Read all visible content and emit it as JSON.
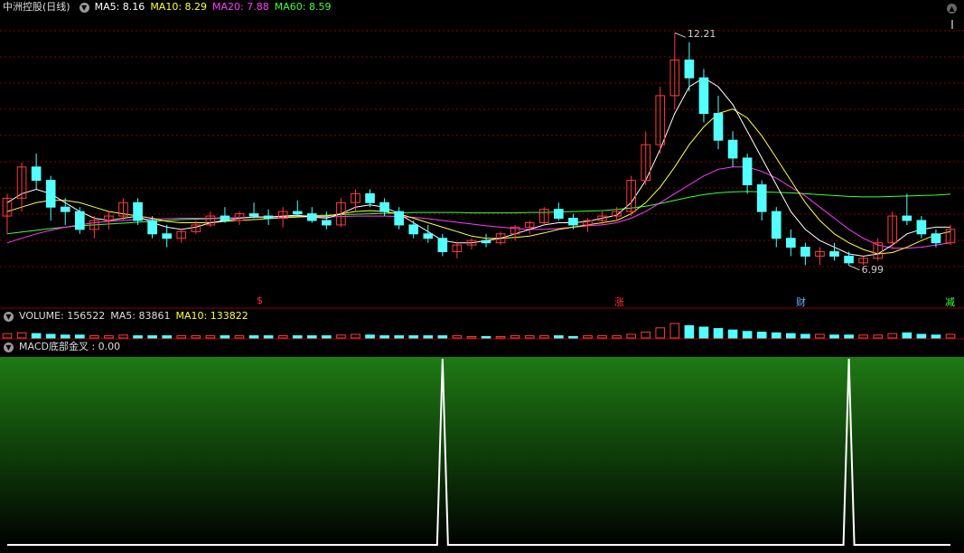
{
  "price_panel": {
    "title": "中洲控股(日线)",
    "ma_labels": [
      {
        "text": "MA5: 8.16",
        "color": "#ffffff"
      },
      {
        "text": "MA10: 8.29",
        "color": "#ffff3c"
      },
      {
        "text": "MA20: 7.88",
        "color": "#ff3cff"
      },
      {
        "text": "MA60: 8.59",
        "color": "#3cff3c"
      }
    ],
    "high_label": "12.21",
    "low_label": "6.99",
    "signals": [
      {
        "text": "$",
        "color": "#ff3030"
      },
      {
        "text": "涨",
        "color": "#ff3030"
      },
      {
        "text": "财",
        "color": "#6ab0ff"
      },
      {
        "text": "减",
        "color": "#3cff3c"
      }
    ]
  },
  "volume_panel": {
    "labels": [
      {
        "text": "VOLUME: 156522",
        "color": "#dddddd"
      },
      {
        "text": "MA5: 83861",
        "color": "#dddddd"
      },
      {
        "text": "MA10: 133822",
        "color": "#ffff3c"
      }
    ]
  },
  "macd_panel": {
    "label": "MACD底部金叉 : 0.00"
  },
  "colors": {
    "up": "#ff3c3c",
    "down": "#54ffff",
    "ma5": "#ffffff",
    "ma10": "#ffff3c",
    "ma20": "#ff3cff",
    "ma60": "#3cff3c",
    "grid": "#8b0000",
    "macd_bg_top": "#1f7a14",
    "macd_bg_bottom": "#000000"
  },
  "chart_data": {
    "type": "candlestick",
    "y_range": [
      6.5,
      12.5
    ],
    "ohlc": [
      [
        8.1,
        8.6,
        7.7,
        8.5
      ],
      [
        8.5,
        9.3,
        8.2,
        9.2
      ],
      [
        9.2,
        9.5,
        8.7,
        8.9
      ],
      [
        8.9,
        9.0,
        8.0,
        8.3
      ],
      [
        8.3,
        8.5,
        7.9,
        8.2
      ],
      [
        8.2,
        8.3,
        7.7,
        7.8
      ],
      [
        7.8,
        8.1,
        7.6,
        8.0
      ],
      [
        8.0,
        8.2,
        7.8,
        8.1
      ],
      [
        8.1,
        8.5,
        8.0,
        8.4
      ],
      [
        8.4,
        8.5,
        7.9,
        8.0
      ],
      [
        8.0,
        8.1,
        7.6,
        7.7
      ],
      [
        7.7,
        7.9,
        7.4,
        7.6
      ],
      [
        7.6,
        7.8,
        7.5,
        7.75
      ],
      [
        7.75,
        8.0,
        7.7,
        7.9
      ],
      [
        7.9,
        8.2,
        7.85,
        8.1
      ],
      [
        8.1,
        8.3,
        7.95,
        8.0
      ],
      [
        8.0,
        8.2,
        7.9,
        8.15
      ],
      [
        8.15,
        8.4,
        8.05,
        8.1
      ],
      [
        8.1,
        8.25,
        7.9,
        8.05
      ],
      [
        8.05,
        8.3,
        7.85,
        8.2
      ],
      [
        8.2,
        8.45,
        8.1,
        8.15
      ],
      [
        8.15,
        8.3,
        7.95,
        8.0
      ],
      [
        8.0,
        8.2,
        7.8,
        7.9
      ],
      [
        7.9,
        8.5,
        7.85,
        8.4
      ],
      [
        8.4,
        8.7,
        8.2,
        8.6
      ],
      [
        8.6,
        8.7,
        8.3,
        8.4
      ],
      [
        8.4,
        8.5,
        8.1,
        8.2
      ],
      [
        8.2,
        8.3,
        7.8,
        7.9
      ],
      [
        7.9,
        8.0,
        7.6,
        7.7
      ],
      [
        7.7,
        7.9,
        7.5,
        7.6
      ],
      [
        7.6,
        7.7,
        7.2,
        7.3
      ],
      [
        7.3,
        7.5,
        7.15,
        7.45
      ],
      [
        7.45,
        7.6,
        7.35,
        7.55
      ],
      [
        7.55,
        7.7,
        7.4,
        7.5
      ],
      [
        7.5,
        7.75,
        7.45,
        7.7
      ],
      [
        7.7,
        7.9,
        7.55,
        7.85
      ],
      [
        7.85,
        8.0,
        7.7,
        7.95
      ],
      [
        7.95,
        8.3,
        7.9,
        8.25
      ],
      [
        8.25,
        8.4,
        8.0,
        8.05
      ],
      [
        8.05,
        8.15,
        7.8,
        7.9
      ],
      [
        7.9,
        8.05,
        7.75,
        8.0
      ],
      [
        8.0,
        8.2,
        7.9,
        8.1
      ],
      [
        8.1,
        8.3,
        8.0,
        8.2
      ],
      [
        8.2,
        9.0,
        8.1,
        8.9
      ],
      [
        8.9,
        10.0,
        8.8,
        9.7
      ],
      [
        9.7,
        11.0,
        9.5,
        10.8
      ],
      [
        10.8,
        12.21,
        10.5,
        11.6
      ],
      [
        11.6,
        12.0,
        10.9,
        11.2
      ],
      [
        11.2,
        11.4,
        10.2,
        10.4
      ],
      [
        10.4,
        10.8,
        9.6,
        9.8
      ],
      [
        9.8,
        10.0,
        9.2,
        9.4
      ],
      [
        9.4,
        9.5,
        8.6,
        8.8
      ],
      [
        8.8,
        8.9,
        8.0,
        8.2
      ],
      [
        8.2,
        8.3,
        7.4,
        7.6
      ],
      [
        7.6,
        7.8,
        7.2,
        7.4
      ],
      [
        7.4,
        7.5,
        7.0,
        7.2
      ],
      [
        7.2,
        7.4,
        7.0,
        7.3
      ],
      [
        7.3,
        7.5,
        7.1,
        7.2
      ],
      [
        7.2,
        7.3,
        6.99,
        7.05
      ],
      [
        7.05,
        7.2,
        7.0,
        7.15
      ],
      [
        7.15,
        7.6,
        7.1,
        7.5
      ],
      [
        7.5,
        8.2,
        7.4,
        8.1
      ],
      [
        8.1,
        8.6,
        7.9,
        8.0
      ],
      [
        8.0,
        8.1,
        7.6,
        7.7
      ],
      [
        7.7,
        7.8,
        7.4,
        7.5
      ],
      [
        7.5,
        7.9,
        7.45,
        7.8
      ]
    ],
    "ma5": [
      8.4,
      8.6,
      8.7,
      8.6,
      8.4,
      8.2,
      8.05,
      8.0,
      8.05,
      8.1,
      7.95,
      7.85,
      7.8,
      7.85,
      7.95,
      8.0,
      8.05,
      8.08,
      8.08,
      8.1,
      8.12,
      8.08,
      8.05,
      8.15,
      8.3,
      8.35,
      8.3,
      8.15,
      7.95,
      7.75,
      7.55,
      7.5,
      7.5,
      7.55,
      7.6,
      7.7,
      7.8,
      7.9,
      7.95,
      7.95,
      7.98,
      8.05,
      8.12,
      8.4,
      8.9,
      9.6,
      10.4,
      11.0,
      11.2,
      11.0,
      10.6,
      10.0,
      9.4,
      8.8,
      8.2,
      7.8,
      7.55,
      7.4,
      7.25,
      7.2,
      7.25,
      7.45,
      7.7,
      7.8,
      7.85,
      7.85
    ],
    "ma10": [
      8.2,
      8.3,
      8.4,
      8.45,
      8.45,
      8.4,
      8.3,
      8.2,
      8.15,
      8.1,
      8.05,
      7.98,
      7.95,
      7.95,
      7.95,
      7.98,
      8.0,
      8.02,
      8.04,
      8.06,
      8.08,
      8.1,
      8.1,
      8.15,
      8.2,
      8.22,
      8.2,
      8.15,
      8.05,
      7.95,
      7.85,
      7.75,
      7.65,
      7.6,
      7.6,
      7.62,
      7.65,
      7.72,
      7.8,
      7.85,
      7.9,
      7.95,
      8.0,
      8.15,
      8.4,
      8.75,
      9.2,
      9.7,
      10.1,
      10.4,
      10.5,
      10.3,
      9.9,
      9.4,
      8.9,
      8.4,
      8.0,
      7.7,
      7.5,
      7.35,
      7.25,
      7.28,
      7.4,
      7.55,
      7.68,
      7.75
    ],
    "ma20": [
      7.5,
      7.6,
      7.7,
      7.78,
      7.85,
      7.9,
      7.95,
      7.98,
      8.0,
      8.02,
      8.03,
      8.04,
      8.05,
      8.05,
      8.05,
      8.06,
      8.06,
      8.07,
      8.08,
      8.08,
      8.08,
      8.08,
      8.08,
      8.09,
      8.1,
      8.1,
      8.1,
      8.09,
      8.07,
      8.04,
      8.0,
      7.96,
      7.92,
      7.88,
      7.85,
      7.82,
      7.8,
      7.8,
      7.82,
      7.85,
      7.88,
      7.9,
      7.95,
      8.05,
      8.2,
      8.4,
      8.6,
      8.8,
      9.0,
      9.15,
      9.2,
      9.2,
      9.1,
      8.95,
      8.75,
      8.55,
      8.3,
      8.05,
      7.8,
      7.6,
      7.45,
      7.38,
      7.38,
      7.4,
      7.45,
      7.5
    ],
    "ma60": [
      7.7,
      7.74,
      7.78,
      7.82,
      7.85,
      7.88,
      7.9,
      7.92,
      7.94,
      7.96,
      7.98,
      8.0,
      8.02,
      8.03,
      8.04,
      8.05,
      8.06,
      8.07,
      8.08,
      8.09,
      8.1,
      8.11,
      8.12,
      8.13,
      8.14,
      8.15,
      8.16,
      8.17,
      8.18,
      8.18,
      8.18,
      8.18,
      8.17,
      8.17,
      8.17,
      8.17,
      8.18,
      8.18,
      8.19,
      8.2,
      8.21,
      8.22,
      8.25,
      8.28,
      8.32,
      8.38,
      8.45,
      8.52,
      8.58,
      8.62,
      8.64,
      8.65,
      8.64,
      8.63,
      8.62,
      8.6,
      8.58,
      8.56,
      8.54,
      8.53,
      8.53,
      8.54,
      8.55,
      8.56,
      8.57,
      8.59
    ],
    "volume": [
      6,
      7,
      6,
      5,
      4,
      4,
      3,
      3,
      4,
      3,
      3,
      3,
      3,
      3,
      3,
      3,
      3,
      3,
      3,
      3,
      3,
      3,
      3,
      4,
      5,
      4,
      3,
      3,
      3,
      3,
      3,
      3,
      2,
      2,
      2,
      3,
      3,
      3,
      3,
      2,
      3,
      3,
      3,
      5,
      8,
      14,
      20,
      17,
      15,
      13,
      11,
      9,
      8,
      7,
      6,
      5,
      5,
      4,
      4,
      4,
      4,
      6,
      7,
      5,
      4,
      5
    ],
    "macd_signal": [
      0,
      0,
      0,
      0,
      0,
      0,
      0,
      0,
      0,
      0,
      0,
      0,
      0,
      0,
      0,
      0,
      0,
      0,
      0,
      0,
      0,
      0,
      0,
      0,
      0,
      0,
      0,
      0,
      0,
      0,
      1,
      0,
      0,
      0,
      0,
      0,
      0,
      0,
      0,
      0,
      0,
      0,
      0,
      0,
      0,
      0,
      0,
      0,
      0,
      0,
      0,
      0,
      0,
      0,
      0,
      0,
      0,
      0,
      1,
      0,
      0,
      0,
      0,
      0,
      0,
      0
    ]
  }
}
